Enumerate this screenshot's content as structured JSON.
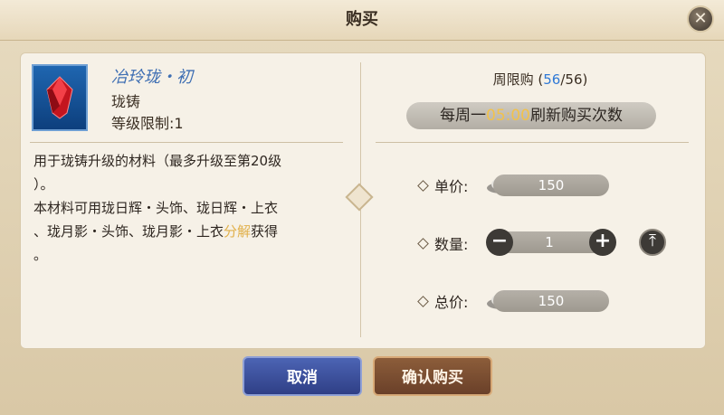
{
  "dialog": {
    "title": "购买",
    "close_icon": "close-icon"
  },
  "item": {
    "name": "冶玲珑・初",
    "type": "珑铸",
    "level_label": "等级限制:1",
    "icon": "red-gem-icon",
    "desc_line1": "用于珑铸升级的材料（最多升级至第20级",
    "desc_line2": "）。",
    "desc_line3": "本材料可用珑日辉・头饰、珑日辉・上衣",
    "desc_line4_pre": "、珑月影・头饰、珑月影・上衣",
    "desc_line4_hl": "分解",
    "desc_line4_post": "获得",
    "desc_line5": "。"
  },
  "purchase": {
    "weekly_label_prefix": "周限购 (",
    "weekly_remaining": "56",
    "weekly_sep": "/",
    "weekly_total": "56",
    "weekly_label_suffix": ")",
    "refresh_prefix": "每周一",
    "refresh_time": "05:00",
    "refresh_suffix": "刷新购买次数",
    "unit_price_label": "单价:",
    "unit_price": "150",
    "quantity_label": "数量:",
    "quantity": "1",
    "total_label": "总价:",
    "total_price": "150",
    "currency_icon": "silver-ingot-icon"
  },
  "buttons": {
    "cancel": "取消",
    "confirm": "确认购买"
  },
  "colors": {
    "accent_blue": "#2f79d6",
    "highlight_gold": "#e1b04a",
    "refresh_time": "#f2c24a"
  }
}
